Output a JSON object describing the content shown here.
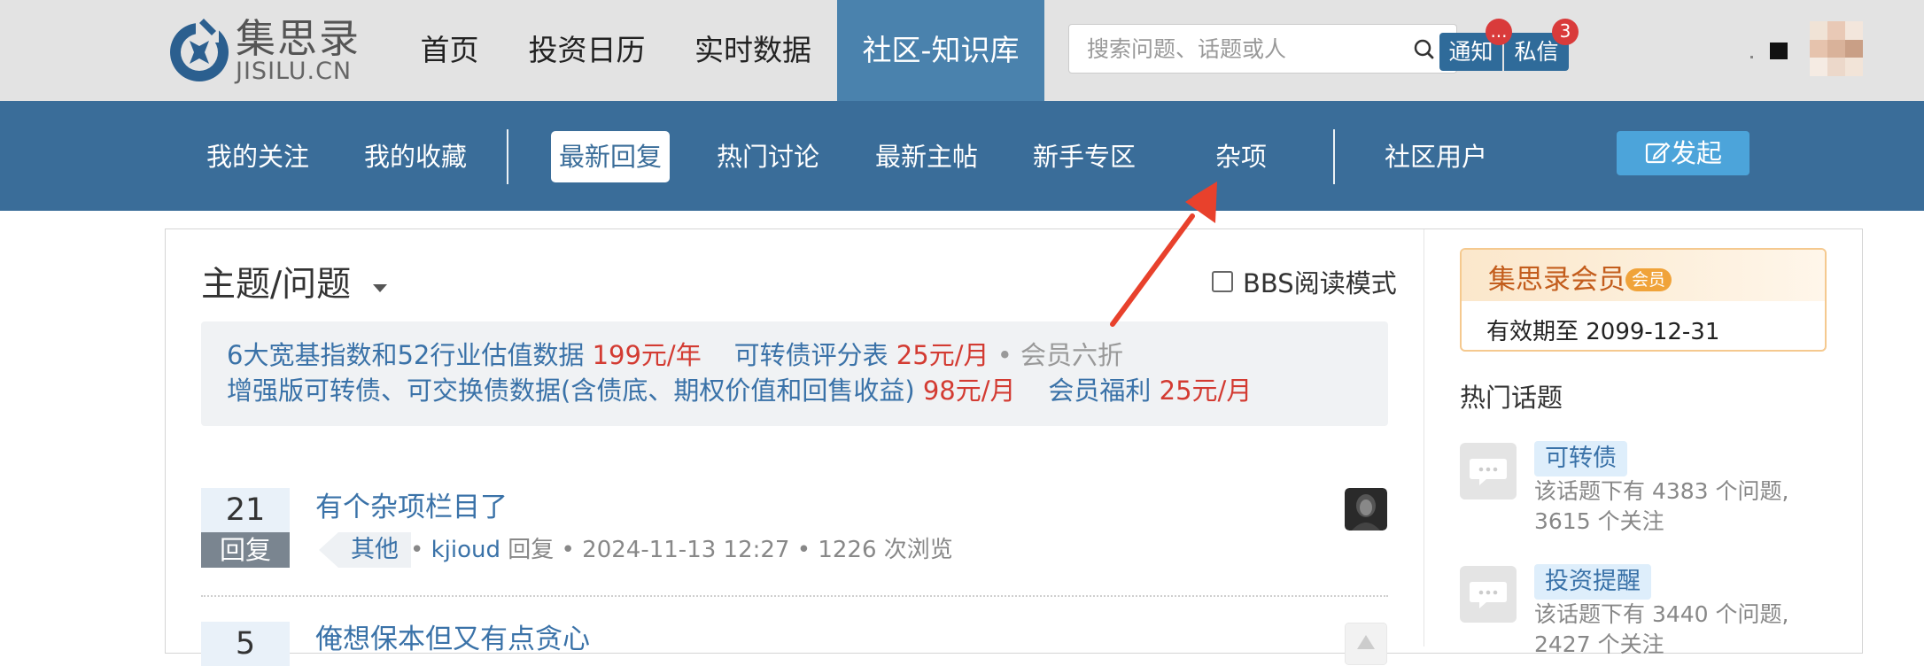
{
  "header": {
    "logo_name": "集思录",
    "logo_domain": "JISILU.CN",
    "nav": [
      {
        "label": "首页"
      },
      {
        "label": "投资日历"
      },
      {
        "label": "实时数据"
      },
      {
        "label": "社区-知识库",
        "active": true
      }
    ],
    "search_placeholder": "搜索问题、话题或人",
    "notify_label": "通知",
    "notify_badge": "...",
    "message_label": "私信",
    "message_badge": "3"
  },
  "subnav": {
    "items": [
      {
        "label": "我的关注"
      },
      {
        "label": "我的收藏"
      },
      {
        "label": "最新回复",
        "active": true
      },
      {
        "label": "热门讨论"
      },
      {
        "label": "最新主帖"
      },
      {
        "label": "新手专区"
      },
      {
        "label": "杂项"
      },
      {
        "label": "社区用户"
      }
    ],
    "launch_label": "发起"
  },
  "main": {
    "title": "主题/问题",
    "bbs_label": "BBS阅读模式",
    "promo": {
      "line1": [
        {
          "text": "6大宽基指数和52行业估值数据 ",
          "style": "blue"
        },
        {
          "text": "199元/年",
          "style": "red"
        },
        {
          "text": "    可转债评分表 ",
          "style": "blue"
        },
        {
          "text": "25元/月",
          "style": "red"
        },
        {
          "text": " • 会员六折",
          "style": "gray"
        }
      ],
      "line2": [
        {
          "text": "增强版可转债、可交换债数据(含债底、期权价值和回售收益) ",
          "style": "blue"
        },
        {
          "text": "98元/月",
          "style": "red"
        },
        {
          "text": "    会员福利 ",
          "style": "blue"
        },
        {
          "text": "25元/月",
          "style": "red"
        }
      ]
    },
    "posts": [
      {
        "reply_count": "21",
        "reply_label": "回复",
        "title": "有个杂项栏目了",
        "tag": "其他",
        "user": "kjioud",
        "action": "回复",
        "time": "2024-11-13 12:27",
        "views": "1226 次浏览"
      },
      {
        "reply_count": "5",
        "title": "俺想保本但又有点贪心"
      }
    ]
  },
  "sidebar": {
    "member_title": "集思录会员",
    "member_badge": "会员",
    "member_expire": "有效期至 2099-12-31",
    "hot_title": "热门话题",
    "topics": [
      {
        "name": "可转债",
        "line1": "该话题下有 4383 个问题,",
        "line2": "3615 个关注"
      },
      {
        "name": "投资提醒",
        "line1": "该话题下有 3440 个问题,",
        "line2": "2427 个关注"
      }
    ]
  },
  "colors": {
    "topbar": "#e3e3e3",
    "nav_active": "#4a82ad",
    "subnav": "#3a6d99",
    "link_blue": "#3a72a8",
    "price_red": "#d33b32",
    "annotation_arrow": "#e8412c"
  }
}
